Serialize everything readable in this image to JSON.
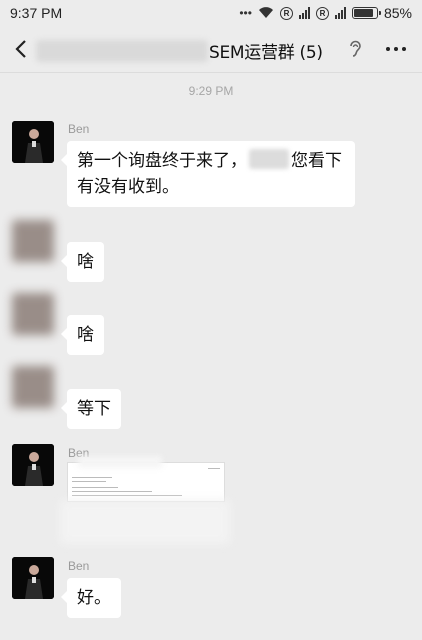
{
  "status_bar": {
    "time": "9:37 PM",
    "battery": "85%",
    "battery_level": 0.85,
    "icons": [
      "dots-icon",
      "wifi-icon",
      "registered-icon",
      "signal-icon",
      "registered-icon",
      "signal-icon",
      "battery-icon"
    ]
  },
  "nav": {
    "title": "SEM运营群 (5)",
    "back_icon": "chevron-left-icon",
    "ear_icon": "earpiece-icon",
    "more_icon": "more-dots-icon"
  },
  "chat": {
    "timestamp": "9:29 PM",
    "messages": [
      {
        "sender": "Ben",
        "text_before": "第一个询盘终于来了，",
        "text_after": "您看下",
        "text_line2": "有没有收到。"
      },
      {
        "sender": "",
        "text": "啥"
      },
      {
        "sender": "",
        "text": "啥"
      },
      {
        "sender": "",
        "text": "等下"
      },
      {
        "sender": "Ben",
        "type": "image"
      },
      {
        "sender": "Ben",
        "text": "好。"
      }
    ]
  }
}
